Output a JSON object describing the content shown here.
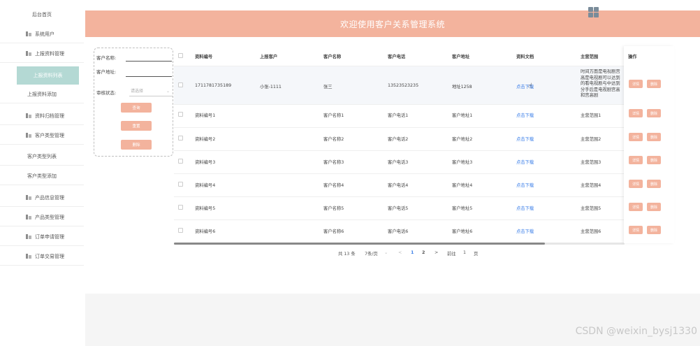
{
  "sidebar": {
    "home": "后台首页",
    "system_users": "系统用户",
    "report_mgmt": "上报资料管理",
    "report_list": "上报资料列表",
    "report_add": "上报资料添加",
    "archive_mgmt": "资料归档管理",
    "customer_type_mgmt": "客户类型管理",
    "customer_type_list": "客户类型列表",
    "customer_type_add": "客户类型添加",
    "product_info_mgmt": "产品信息管理",
    "product_type_mgmt": "产品类型管理",
    "order_apply_mgmt": "订单申请管理",
    "order_trade_mgmt": "订单交易管理"
  },
  "header": {
    "title": "欢迎使用客户关系管理系统"
  },
  "search": {
    "name_label": "客户名称:",
    "address_label": "客户地址:",
    "status_label": "审核状态:",
    "status_placeholder": "请选择",
    "btn_query": "查询",
    "btn_reset": "重置",
    "btn_delete": "删除"
  },
  "table": {
    "headers": [
      "资料编号",
      "上报客户",
      "客户名称",
      "客户电话",
      "客户地址",
      "资料文档",
      "主营范围",
      "操作"
    ],
    "rows": [
      [
        "1711781735189",
        "小张-1111",
        "张三",
        "13523523235",
        "地址1258",
        "点击下载",
        "时间方面是电视剧宫高是电视剧可以达到的看电视剧与中达到分手后是电视剧宫高和宫高剧"
      ],
      [
        "资料编号1",
        "",
        "客户名称1",
        "客户电话1",
        "客户地址1",
        "点击下载",
        "主营范围1"
      ],
      [
        "资料编号2",
        "",
        "客户名称2",
        "客户电话2",
        "客户地址2",
        "点击下载",
        "主营范围2"
      ],
      [
        "资料编号3",
        "",
        "客户名称3",
        "客户电话3",
        "客户地址3",
        "点击下载",
        "主营范围3"
      ],
      [
        "资料编号4",
        "",
        "客户名称4",
        "客户电话4",
        "客户地址4",
        "点击下载",
        "主营范围4"
      ],
      [
        "资料编号5",
        "",
        "客户名称5",
        "客户电话5",
        "客户地址5",
        "点击下载",
        "主营范围5"
      ],
      [
        "资料编号6",
        "",
        "客户名称6",
        "客户电话6",
        "客户地址6",
        "点击下载",
        "主营范围6"
      ]
    ],
    "btn_detail": "详情",
    "btn_delete": "删除"
  },
  "pagination": {
    "total": "共 13 条",
    "page_size": "7条/页",
    "prev": "<",
    "page1": "1",
    "page2": "2",
    "next": ">",
    "goto_label": "前往",
    "goto_value": "1",
    "page_unit": "页"
  },
  "watermark": "CSDN @weixin_bysj1330",
  "colors": {
    "accent": "#f3b39d",
    "active_menu": "#b4d9d4",
    "link": "#3a7ee8"
  }
}
